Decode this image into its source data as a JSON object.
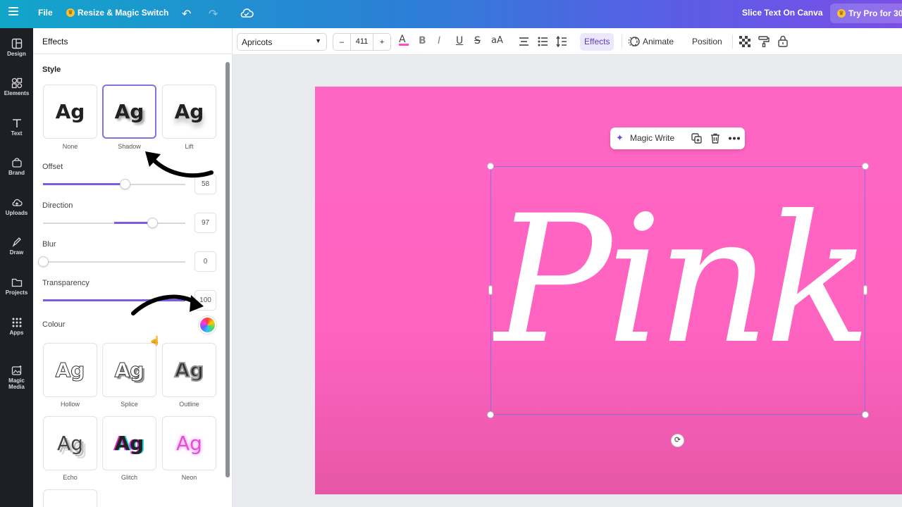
{
  "topbar": {
    "file_label": "File",
    "resize_label": "Resize & Magic Switch",
    "doc_title": "Slice Text On Canva",
    "try_pro_label": "Try Pro for 30"
  },
  "rail": {
    "items": [
      {
        "label": "Design",
        "icon": "layout-icon"
      },
      {
        "label": "Elements",
        "icon": "shapes-icon"
      },
      {
        "label": "Text",
        "icon": "text-icon"
      },
      {
        "label": "Brand",
        "icon": "brand-icon"
      },
      {
        "label": "Uploads",
        "icon": "cloud-upload-icon"
      },
      {
        "label": "Draw",
        "icon": "pen-icon"
      },
      {
        "label": "Projects",
        "icon": "folder-icon"
      },
      {
        "label": "Apps",
        "icon": "grid-icon"
      },
      {
        "label": "Magic Media",
        "icon": "magic-media-icon"
      }
    ]
  },
  "panel": {
    "title": "Effects",
    "style_label": "Style",
    "styles_top": [
      {
        "caption": "None",
        "sample": "Ag"
      },
      {
        "caption": "Shadow",
        "sample": "Ag"
      },
      {
        "caption": "Lift",
        "sample": "Ag"
      }
    ],
    "sliders": [
      {
        "label": "Offset",
        "value": "58"
      },
      {
        "label": "Direction",
        "value": "97"
      },
      {
        "label": "Blur",
        "value": "0"
      },
      {
        "label": "Transparency",
        "value": "100"
      }
    ],
    "colour_label": "Colour",
    "styles_bottom": [
      {
        "caption": "Hollow",
        "sample": "Ag"
      },
      {
        "caption": "Splice",
        "sample": "Ag"
      },
      {
        "caption": "Outline",
        "sample": "Ag"
      },
      {
        "caption": "Echo",
        "sample": "Ag"
      },
      {
        "caption": "Glitch",
        "sample": "Ag"
      },
      {
        "caption": "Neon",
        "sample": "Ag"
      }
    ]
  },
  "toolbar": {
    "font": "Apricots",
    "font_size": "411",
    "minus": "–",
    "plus": "+",
    "effects_label": "Effects",
    "animate_label": "Animate",
    "position_label": "Position"
  },
  "canvas": {
    "magic_write_label": "Magic Write",
    "text": "Pink",
    "background_color": "#ff66c4",
    "accent_color": "#7d5be6"
  }
}
